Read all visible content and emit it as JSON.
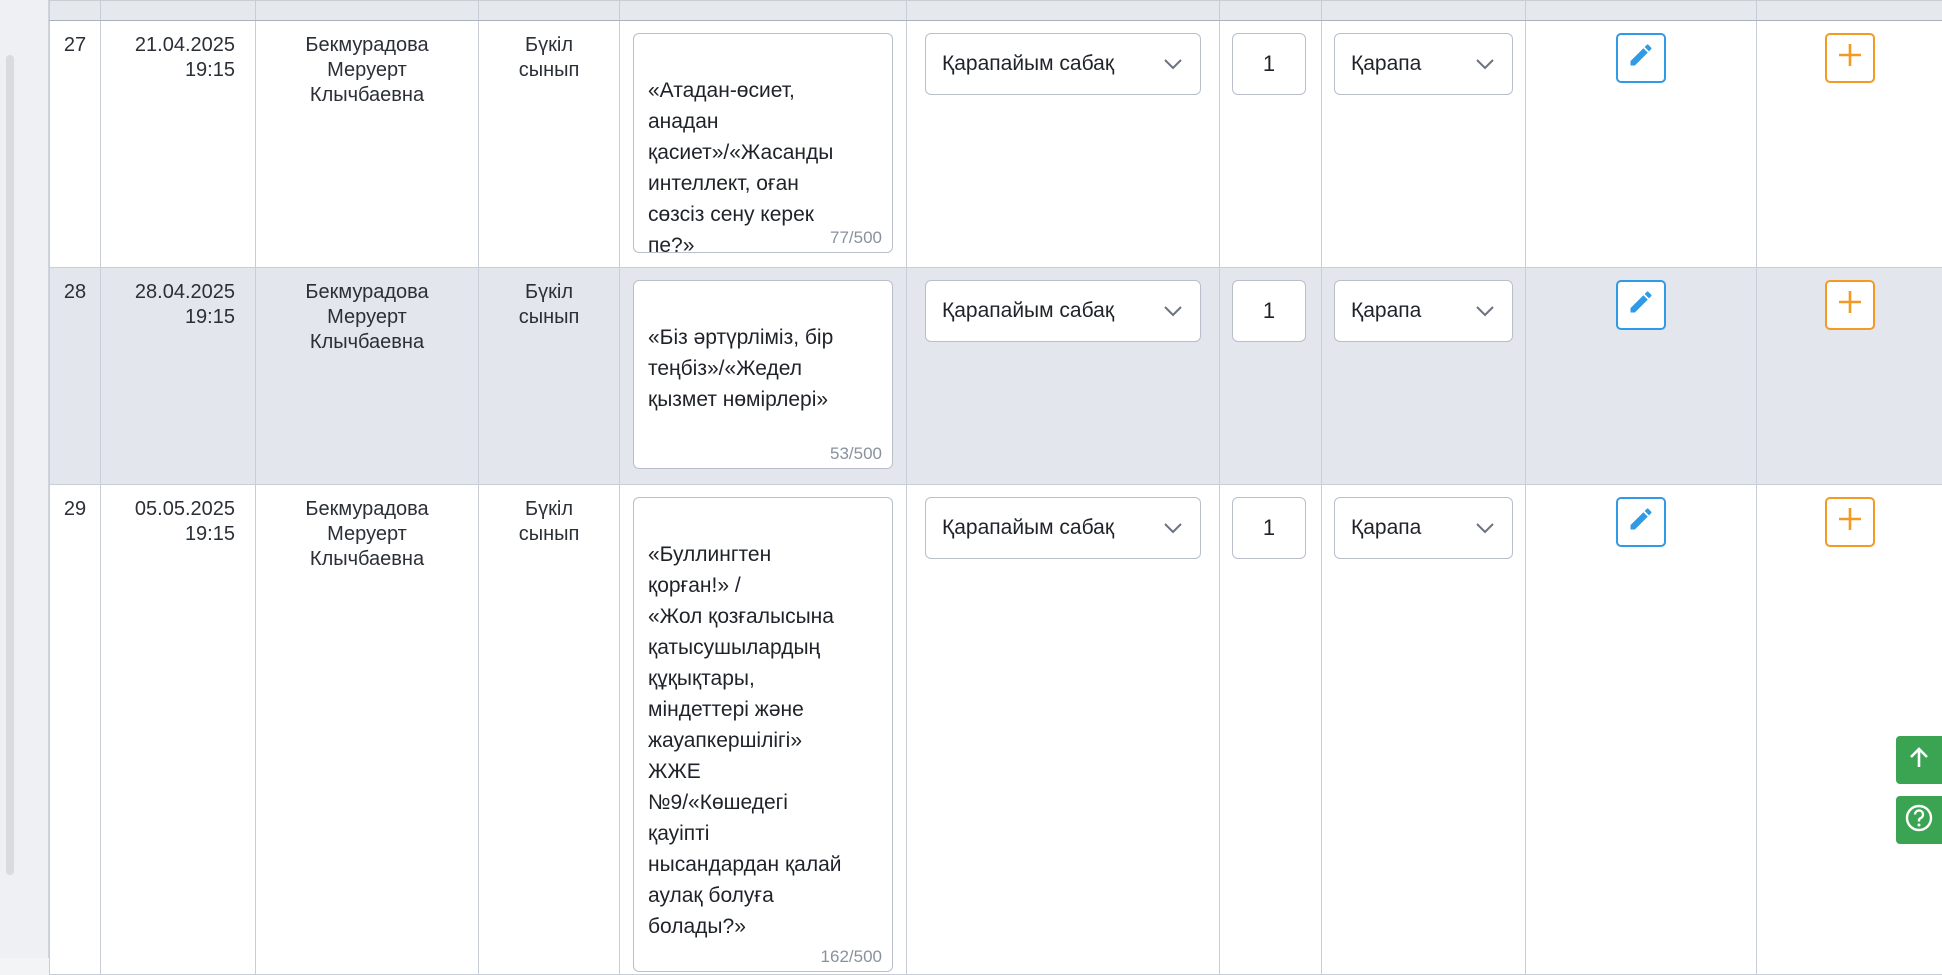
{
  "rows": [
    {
      "num": "27",
      "date": "21.04.2025",
      "time": "19:15",
      "teacher": [
        "Бекмурадова",
        "Меруерт",
        "Клычбаевна"
      ],
      "group": [
        "Бүкіл",
        "сынып"
      ],
      "topic": "«Атадан-өсиет,\nанадан\nқасиет»/«Жасанды\nинтеллект, оған\nсөзсіз сену керек\nпе?»",
      "counter": "77/500",
      "lesson_type": "Қарапайым сабақ",
      "hours": "1",
      "type_short": "Қарапа"
    },
    {
      "num": "28",
      "date": "28.04.2025",
      "time": "19:15",
      "teacher": [
        "Бекмурадова",
        "Меруерт",
        "Клычбаевна"
      ],
      "group": [
        "Бүкіл",
        "сынып"
      ],
      "topic": "«Біз әртүрліміз, бір\nтеңбіз»/«Жедел\nқызмет нөмірлері»",
      "counter": "53/500",
      "lesson_type": "Қарапайым сабақ",
      "hours": "1",
      "type_short": "Қарапа"
    },
    {
      "num": "29",
      "date": "05.05.2025",
      "time": "19:15",
      "teacher": [
        "Бекмурадова",
        "Меруерт",
        "Клычбаевна"
      ],
      "group": [
        "Бүкіл",
        "сынып"
      ],
      "topic": "«Буллингтен\nқорған!» /\n«Жол қозғалысына\nқатысушылардың\nқұқықтары,\nміндеттері және\nжауапкершілігі»\nЖЖЕ\n№9/«Көшедегі\nқауіпті\nнысандардан қалай\nаулақ болуға\nболады?»",
      "counter": "162/500",
      "lesson_type": "Қарапайым сабақ",
      "hours": "1",
      "type_short": "Қарапа"
    }
  ],
  "icons": {
    "chevron": "chevron-down-icon",
    "edit": "pencil-icon",
    "add": "plus-icon",
    "scroll_top": "arrow-up-icon",
    "help": "question-circle-icon"
  },
  "colors": {
    "edit": "#2f9ae6",
    "add": "#f29a24",
    "float": "#3aa453",
    "row_alt": "#e3e6ec"
  }
}
